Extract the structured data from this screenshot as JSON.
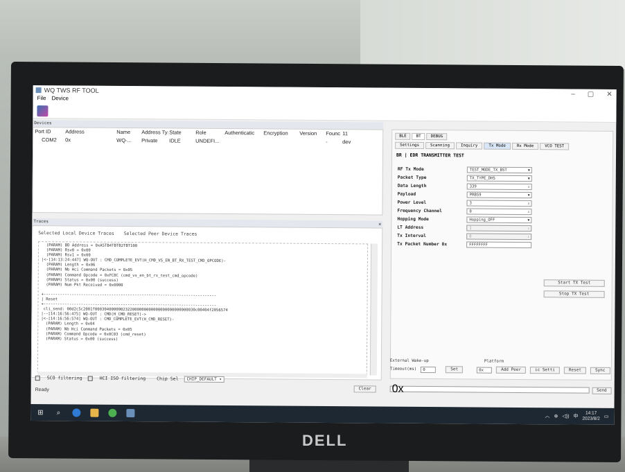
{
  "window": {
    "title": "WQ TWS RF TOOL",
    "controls": [
      "–",
      "▢",
      "✕"
    ]
  },
  "menu": [
    "File",
    "Device"
  ],
  "devices": {
    "header": "Devices",
    "columns": [
      "Port ID",
      "Address",
      "Name",
      "Address Typ",
      "State",
      "Role",
      "Authenticatic",
      "Encryption",
      "Version",
      "Founc",
      "11"
    ],
    "row": [
      "COM2",
      "0x",
      "WQ-...",
      "Private",
      "IDLE",
      "UNDEFI...",
      "",
      "",
      "",
      "-",
      "dev"
    ]
  },
  "traces": {
    "header": "Traces",
    "tabs": [
      "Selected Local Device Traces",
      "Selected Peer Device Traces"
    ],
    "lines": [
      "  (PARAM) BD Address = 0xA5TB4TBTB2TBT100",
      "  (PARAM) Rsv0 = 0x00",
      "  (PARAM) Rsv1 = 0x00",
      "|<-[14:13:24:447] WQ-OUT : CMD_COMPLETE_EVT(H_CMD_VS_EN_BT_RX_TEST_CMD_OPCODE)-",
      "  (PARAM) Length = 0x06",
      "  (PARAM) Nb Hci Command Packets = 0x05",
      "  (PARAM) Command Opcode = 0xFC8C (cmd_vs_en_bt_rx_test_cmd_opcode)",
      "  (PARAM) Status = 0x00 (success)",
      "  (PARAM) Num Pkt Received = 0x0000",
      "",
      "+--------------------------------------------------------------------------",
      "| Reset",
      "+--------------------------------------------------------------------------",
      " cli_send: 00d2c5c2001f0003040000002322000000000000000000000000030c00404f2056574",
      "|--[14:16:56:475] WQ-OUT : CMD(H_CMD_RESET)->",
      "|<-[14:16:56:574] WQ-OUT : CMD_COMPLETE_EVT(H_CMD_RESET)-",
      "  (PARAM) Length = 0x04",
      "  (PARAM) Nb Hci Command Packets = 0x05",
      "  (PARAM) Command Opcode = 0x0C03 (cmd_reset)",
      "  (PARAM) Status = 0x00 (success)"
    ]
  },
  "bottom": {
    "sco_filter": "SCO filtering",
    "hci_filter": "HCI ISO filtering",
    "chip_sel_label": "Chip Sel",
    "chip_sel_value": "CHIP_DEFAULT",
    "clear": "Clear",
    "status": "Ready"
  },
  "right": {
    "tabs": [
      "BLE",
      "BT",
      "DEBUG"
    ],
    "subtabs": [
      "Settings",
      "Scanning",
      "Inquiry",
      "Tx Mode",
      "Rx Mode",
      "VCO TEST"
    ],
    "title": "BR | EDR TRANSMITTER TEST",
    "fields": [
      {
        "label": "RF Tx Mode",
        "value": "TEST_MODE_TX_BST",
        "kind": "select"
      },
      {
        "label": "Packet Type",
        "value": "TX_TYPE_DH5",
        "kind": "select"
      },
      {
        "label": "Data Length",
        "value": "339",
        "kind": "spin"
      },
      {
        "label": "Payload",
        "value": "PRBS9",
        "kind": "select"
      },
      {
        "label": "Power Level",
        "value": "3",
        "kind": "spin"
      },
      {
        "label": "Frequency Channel",
        "value": "0",
        "kind": "spin"
      },
      {
        "label": "Hopping Mode",
        "value": "Hopping_OFF",
        "kind": "select"
      },
      {
        "label": "LT Address",
        "value": "1",
        "kind": "spin-disabled"
      },
      {
        "label": "Tx Interval",
        "value": "0",
        "kind": "spin-disabled"
      },
      {
        "label": "Tx Packet Number 0x",
        "value": "FFFFFFFF",
        "kind": "text"
      }
    ],
    "start_btn": "Start TX Test",
    "stop_btn": "Stop TX Test",
    "ext_wakeup": "External Wake-up",
    "timeout_label": "Timeout(ms)",
    "timeout_value": "0",
    "set": "Set",
    "platform": "Platform",
    "platform_value": "0x",
    "add_peer": "Add Peer",
    "ic_setti": "ic Setti",
    "reset": "Reset",
    "sync": "Sync",
    "send_input": "0x",
    "send": "Send"
  },
  "taskbar": {
    "time": "14:17",
    "date": "2023/8/2",
    "lang": "中"
  },
  "monitor_brand": "DELL"
}
